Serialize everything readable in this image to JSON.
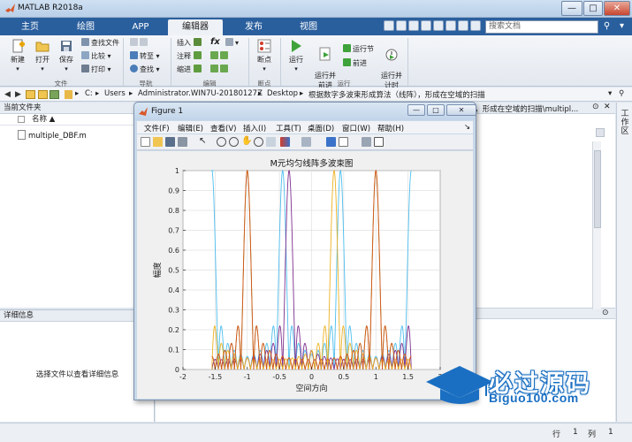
{
  "app": {
    "title": "MATLAB R2018a"
  },
  "titlebar": {
    "minimize": "—",
    "maximize": "□",
    "close": "✕"
  },
  "tabs": [
    {
      "label": "主页"
    },
    {
      "label": "绘图"
    },
    {
      "label": "APP"
    },
    {
      "label": "编辑器"
    },
    {
      "label": "发布"
    },
    {
      "label": "视图"
    }
  ],
  "search": {
    "placeholder": "搜索文档"
  },
  "ribbon": {
    "file": {
      "new": "新建",
      "open": "打开",
      "save": "保存",
      "find_files": "查找文件",
      "compare": "比较",
      "print": "打印",
      "group": "文件"
    },
    "nav": {
      "goto": "转至",
      "find": "查找",
      "group": "导航"
    },
    "edit": {
      "insert": "插入",
      "comment": "注释",
      "indent": "缩进",
      "group": "编辑"
    },
    "breakpoints": {
      "label": "断点",
      "group": "断点"
    },
    "run": {
      "run": "运行",
      "run_advance": "运行并\n前进",
      "run_section": "运行节",
      "advance": "前进",
      "run_time": "运行并\n计时",
      "group": "运行"
    },
    "fx": "fx"
  },
  "address": {
    "drive": "C:",
    "users": "Users",
    "admin": "Administrator.WIN7U-20180127Z",
    "desktop": "Desktop",
    "folder": "根据数字多波束形成算法（线阵），形成在空域的扫描"
  },
  "current_folder": {
    "title": "当前文件夹",
    "name_header": "名称 ▲",
    "files": [
      "multiple_DBF.m"
    ]
  },
  "details": {
    "title": "详细信息",
    "hint": "选择文件以查看详细信息"
  },
  "right_panel": {
    "path_tail": "），形成在空域的扫描\\multipl...",
    "side_tab": "工作区"
  },
  "status": {
    "row_label": "行",
    "row": "1",
    "col_label": "列",
    "col": "1"
  },
  "figure": {
    "title": "Figure 1",
    "menu": [
      "文件(F)",
      "编辑(E)",
      "查看(V)",
      "插入(I)",
      "工具(T)",
      "桌面(D)",
      "窗口(W)",
      "帮助(H)"
    ]
  },
  "chart_data": {
    "type": "line",
    "title": "M元均匀线阵多波束图",
    "xlabel": "空间方向",
    "ylabel": "幅度",
    "xlim": [
      -2,
      2
    ],
    "ylim": [
      0,
      1
    ],
    "xticks": [
      -2,
      -1.5,
      -1,
      -0.5,
      0,
      0.5,
      1,
      1.5,
      2
    ],
    "yticks": [
      0,
      0.1,
      0.2,
      0.3,
      0.4,
      0.5,
      0.6,
      0.7,
      0.8,
      0.9,
      1
    ],
    "grid": true,
    "series": [
      {
        "color": "#4DBEEE",
        "peaks": [
          -1.55,
          1.55
        ]
      },
      {
        "color": "#77AC30",
        "peaks": [
          -1.0
        ]
      },
      {
        "color": "#7E2F8E",
        "peaks": [
          -0.35
        ]
      },
      {
        "color": "#EDB120",
        "peaks": [
          0.35
        ]
      },
      {
        "color": "#D95319",
        "peaks": [
          1.0
        ]
      }
    ]
  },
  "watermark": {
    "cn": "必过源码",
    "en": "Biguo100.com"
  }
}
